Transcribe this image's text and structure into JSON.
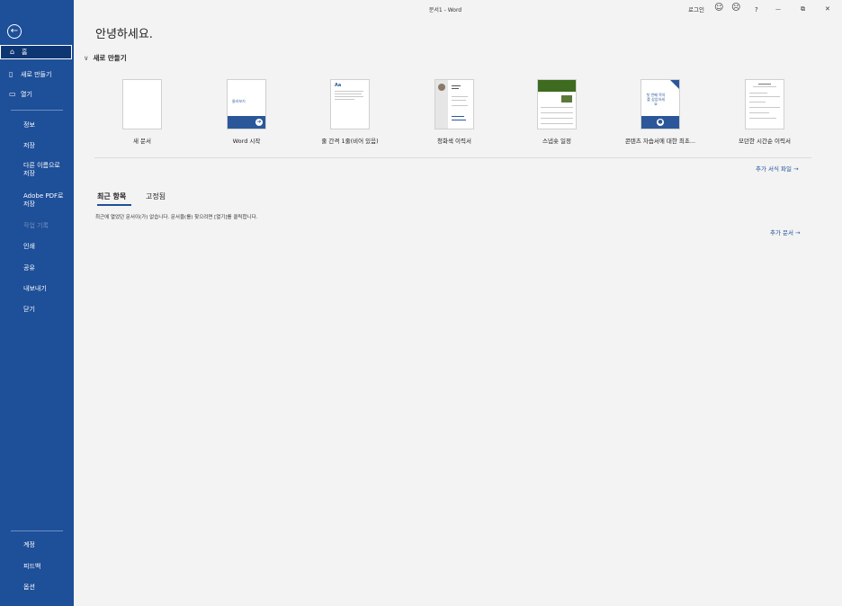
{
  "titlebar": {
    "title": "문서1 - Word",
    "login": "로그인",
    "icons": [
      "smile-icon",
      "frown-icon",
      "help-icon",
      "minimize-icon",
      "restore-icon",
      "close-icon"
    ],
    "help_glyph": "?",
    "minimize_glyph": "—",
    "restore_glyph": "⧉",
    "close_glyph": "✕",
    "smile_glyph": "☺",
    "frown_glyph": "☹"
  },
  "sidebar": {
    "back_glyph": "←",
    "home": "홈",
    "new": "새로 만들기",
    "open": "열기",
    "info": "정보",
    "save": "저장",
    "save_as": "다른 이름으로 저장",
    "save_pdf": "Adobe PDF로 저장",
    "history": "작업 기록",
    "print": "인쇄",
    "share": "공유",
    "export": "내보내기",
    "close": "닫기",
    "account": "계정",
    "feedback": "피드백",
    "options": "옵션"
  },
  "main": {
    "greeting": "안녕하세요.",
    "new_section": "새로 만들기",
    "templates": [
      {
        "label": "새 문서"
      },
      {
        "label": "Word 시작",
        "thumb_text": "둘러보기"
      },
      {
        "label": "줄 간격 1줄(비어 있음)",
        "thumb_text": "Aa"
      },
      {
        "label": "청화색 이력서"
      },
      {
        "label": "스냅숏 일정"
      },
      {
        "label": "콘텐츠 자습서에 대한 최초...",
        "thumb_text": "첫 번째 목차를 삽입하세요"
      },
      {
        "label": "모던한 시간순 이력서"
      }
    ],
    "more_templates": "추가 서식 파일 →",
    "tabs": {
      "recent": "최근 항목",
      "pinned": "고정됨"
    },
    "empty_message": "최근에 열었던 문서이(가) 없습니다. 문서을(를) 찾으려면 [열기]를 클릭합니다.",
    "more_documents": "추가 문서 →"
  },
  "colors": {
    "accent": "#1e4f99",
    "sidebar_selected": "#0d3673",
    "template_blue": "#2b579a",
    "template_green": "#3e6b1f"
  }
}
